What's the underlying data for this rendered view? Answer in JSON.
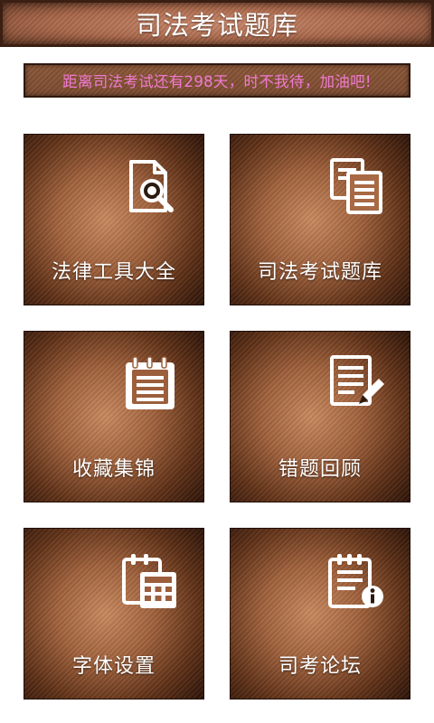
{
  "header": {
    "title": "司法考试题库"
  },
  "countdown": {
    "text": "距离司法考试还有298天，时不我待，加油吧!",
    "text_color": "#f07ad0"
  },
  "tiles": [
    {
      "label": "法律工具大全",
      "icon": "document-search-icon"
    },
    {
      "label": "司法考试题库",
      "icon": "documents-copy-icon"
    },
    {
      "label": "收藏集锦",
      "icon": "notepad-icon"
    },
    {
      "label": "错题回顾",
      "icon": "document-edit-icon"
    },
    {
      "label": "字体设置",
      "icon": "calculator-clipboard-icon"
    },
    {
      "label": "司考论坛",
      "icon": "clipboard-info-icon"
    }
  ],
  "colors": {
    "tile_glow": "#c98a5f",
    "tile_dark": "#2c1308",
    "icon_fill": "#ffffff"
  }
}
